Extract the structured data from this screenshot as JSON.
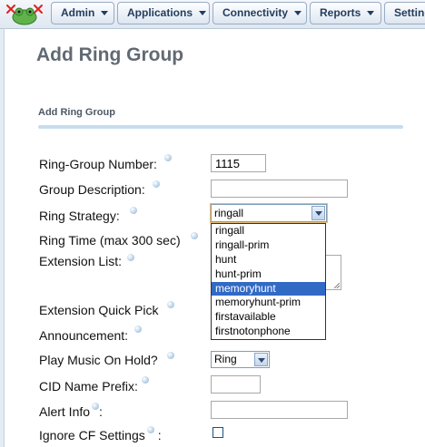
{
  "nav": {
    "tabs": [
      {
        "label": "Admin"
      },
      {
        "label": "Applications"
      },
      {
        "label": "Connectivity"
      },
      {
        "label": "Reports"
      },
      {
        "label": "Setting"
      }
    ]
  },
  "page": {
    "title": "Add Ring Group",
    "section_title": "Add Ring Group"
  },
  "form": {
    "ring_group_number": {
      "label": "Ring-Group Number:",
      "value": "1115"
    },
    "group_description": {
      "label": "Group Description:",
      "value": ""
    },
    "ring_strategy": {
      "label": "Ring Strategy:",
      "value": "ringall",
      "options": [
        "ringall",
        "ringall-prim",
        "hunt",
        "hunt-prim",
        "memoryhunt",
        "memoryhunt-prim",
        "firstavailable",
        "firstnotonphone"
      ],
      "highlighted": "memoryhunt"
    },
    "ring_time": {
      "label": "Ring Time (max 300 sec)"
    },
    "extension_list": {
      "label": "Extension List:"
    },
    "extension_quick_pick": {
      "label": "Extension Quick Pick"
    },
    "announcement": {
      "label": "Announcement:"
    },
    "play_music_on_hold": {
      "label": "Play Music On Hold?",
      "value": "Ring"
    },
    "cid_name_prefix": {
      "label": "CID Name Prefix:",
      "value": ""
    },
    "alert_info": {
      "label": "Alert Info",
      "suffix": ":",
      "value": ""
    },
    "ignore_cf_settings": {
      "label": "Ignore CF Settings",
      "suffix": ":",
      "checked": false
    }
  },
  "colors": {
    "accent": "#316ac5",
    "nav_text": "#233d5e",
    "title_text": "#616a73"
  }
}
